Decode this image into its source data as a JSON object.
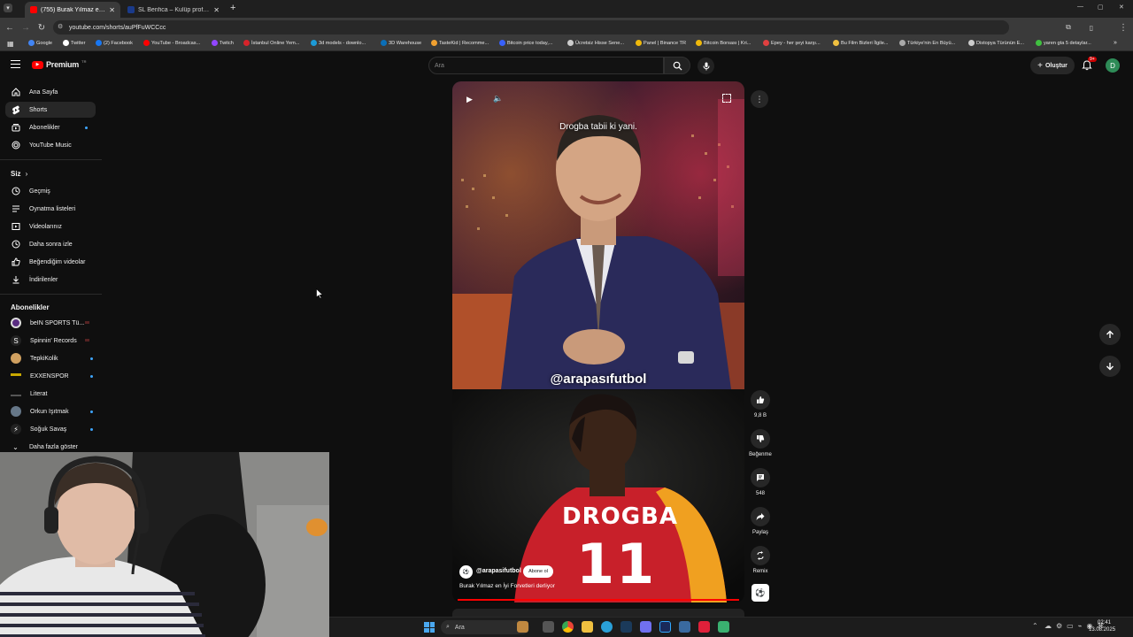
{
  "browser": {
    "tabs": [
      {
        "title": "(755) Burak Yılmaz en İyi Forvet",
        "active": true,
        "favicon_color": "#ff0000"
      },
      {
        "title": "SL Benfica – Kulüp profili | Trans",
        "active": false,
        "favicon_color": "#1a3a8a"
      }
    ],
    "new_tab": "+",
    "url": "youtube.com/shorts/auPfFuWCCcc",
    "window_controls": [
      "—",
      "▢",
      "✕"
    ],
    "bookmarks": [
      {
        "label": "Google",
        "icon_color": "#4285f4"
      },
      {
        "label": "Twitter",
        "icon_color": "#ffffff"
      },
      {
        "label": "(2) Facebook",
        "icon_color": "#1877f2"
      },
      {
        "label": "YouTube - Broadcas...",
        "icon_color": "#ff0000"
      },
      {
        "label": "Twitch",
        "icon_color": "#9146ff"
      },
      {
        "label": "İstanbul Online Yem...",
        "icon_color": "#d6232a"
      },
      {
        "label": "3d models - downlo...",
        "icon_color": "#1c9ad6"
      },
      {
        "label": "3D Warehouse",
        "icon_color": "#0b6fb8"
      },
      {
        "label": "TasteKid | Recomme...",
        "icon_color": "#f0a030"
      },
      {
        "label": "Bitcoin price today,...",
        "icon_color": "#3861fb"
      },
      {
        "label": "Ücretsiz Hisse Sene...",
        "icon_color": "#cccccc"
      },
      {
        "label": "Panel | Binance TR",
        "icon_color": "#f0b90b"
      },
      {
        "label": "Bitcoin Borsası | Kri...",
        "icon_color": "#f0b90b"
      },
      {
        "label": "Epey - her şeyi karşı...",
        "icon_color": "#e04040"
      },
      {
        "label": "Bu Film Bizleri İlgile...",
        "icon_color": "#f0c040"
      },
      {
        "label": "Türkiye'nin En Büyü...",
        "icon_color": "#aaaaaa"
      },
      {
        "label": "Distopya Türünün E...",
        "icon_color": "#cccccc"
      },
      {
        "label": "yaren gta 5 detaylar...",
        "icon_color": "#40c040"
      }
    ]
  },
  "youtube": {
    "logo_text": "Premium",
    "logo_badge": "TR",
    "search_placeholder": "Ara",
    "create_label": "Oluştur",
    "notification_count": "9+",
    "avatar_letter": "D"
  },
  "sidebar": {
    "main": [
      {
        "label": "Ana Sayfa",
        "icon": "home-icon",
        "active": false
      },
      {
        "label": "Shorts",
        "icon": "shorts-icon",
        "active": true
      },
      {
        "label": "Abonelikler",
        "icon": "subscriptions-icon",
        "active": false
      },
      {
        "label": "YouTube Music",
        "icon": "music-icon",
        "active": false
      }
    ],
    "you_heading": "Siz",
    "you_items": [
      {
        "label": "Geçmiş",
        "icon": "history-icon"
      },
      {
        "label": "Oynatma listeleri",
        "icon": "playlists-icon"
      },
      {
        "label": "Videolarınız",
        "icon": "your-videos-icon"
      },
      {
        "label": "Daha sonra izle",
        "icon": "watch-later-icon"
      },
      {
        "label": "Beğendiğim videolar",
        "icon": "liked-icon"
      },
      {
        "label": "İndirilenler",
        "icon": "downloads-icon"
      }
    ],
    "subs_heading": "Abonelikler",
    "subs": [
      {
        "label": "beIN SPORTS Tü...",
        "color": "#5a2d82",
        "live": true
      },
      {
        "label": "Spinnin' Records",
        "color": "#222222",
        "live": true
      },
      {
        "label": "TepkiKolik",
        "color": "#d0a060",
        "live": false
      },
      {
        "label": "EXXENSPOR",
        "color": "#c8a800",
        "live": false
      },
      {
        "label": "Literat",
        "color": "#333333",
        "live": false
      },
      {
        "label": "Orkun Işıtmak",
        "color": "#667788",
        "live": false
      },
      {
        "label": "Soğuk Savaş",
        "color": "#222222",
        "live": false
      }
    ],
    "show_more": "Daha fazla göster"
  },
  "short": {
    "caption_top": "Drogba tabii ki yani.",
    "watermark": "@arapasıfutbol",
    "jersey_name": "DROGBA",
    "jersey_number": "11",
    "channel": "@arapasifutbol",
    "subscribe_label": "Abone ol",
    "title": "Burak Yılmaz en İyi Forvetleri derliyor",
    "actions": {
      "likes": "9,8 B",
      "dislike": "Beğenme",
      "comments": "548",
      "share": "Paylaş",
      "remix": "Remix"
    }
  },
  "taskbar": {
    "search_label": "Ara",
    "time": "02:41",
    "date": "13.08.2025"
  }
}
